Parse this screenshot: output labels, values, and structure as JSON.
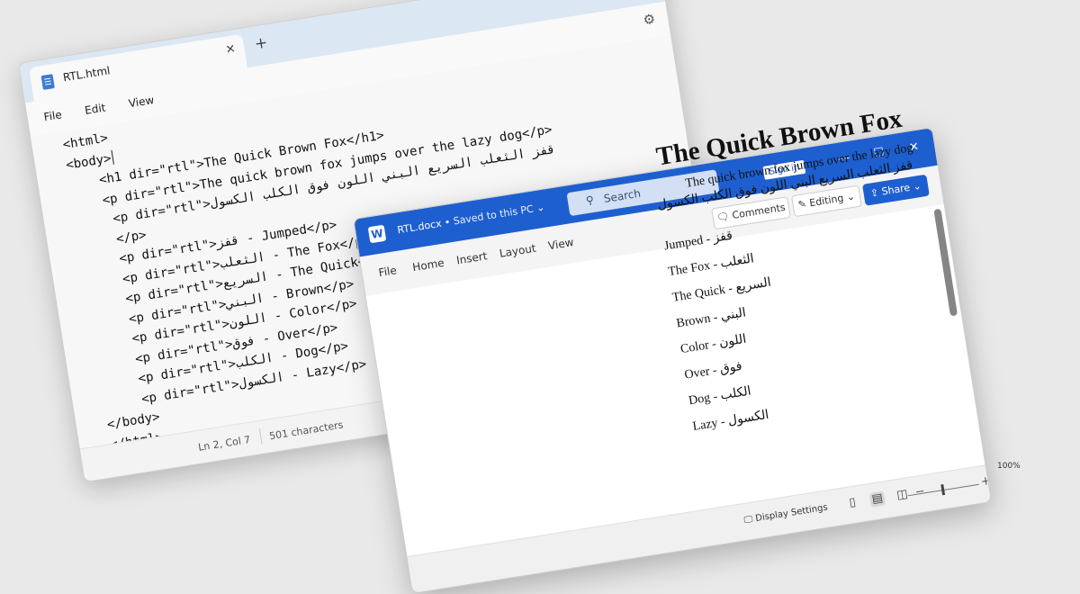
{
  "notepad": {
    "tab_title": "RTL.html",
    "tab_close": "✕",
    "new_tab": "+",
    "menu": [
      "File",
      "Edit",
      "View"
    ],
    "code_lines": [
      "<html>",
      "<body>",
      "    <h1 dir=\"rtl\">The Quick Brown Fox</h1>",
      "    <p dir=\"rtl\">The quick brown fox jumps over the lazy dog</p>",
      "     <p dir=\"rtl\">قفز الثعلب السريع البني اللون فوق الكلب الكسول",
      "     </p>",
      "     <p dir=\"rtl\">قفز - Jumped</p>",
      "     <p dir=\"rtl\">الثعلب - The Fox</p>",
      "     <p dir=\"rtl\">السريع - The Quick</p>",
      "     <p dir=\"rtl\">البني - Brown</p>",
      "     <p dir=\"rtl\">اللون - Color</p>",
      "     <p dir=\"rtl\">فوق - Over</p>",
      "     <p dir=\"rtl\">الكلب - Dog</p>",
      "     <p dir=\"rtl\">الكسول - Lazy</p>",
      "</body>",
      "</html>"
    ],
    "status": {
      "position": "Ln 2, Col 7",
      "characters": "501 characters"
    }
  },
  "word": {
    "logo": "W",
    "doc_name": "RTL.docx",
    "saved": "Saved to this PC",
    "search_placeholder": "Search",
    "sign_in": "Sign in",
    "window_controls": {
      "minimize": "—",
      "maximize": "☐",
      "close": "✕"
    },
    "menu": [
      "File",
      "Home",
      "Insert",
      "Layout",
      "View"
    ],
    "comments": "Comments",
    "editing": "Editing",
    "share": "Share",
    "status": {
      "display_settings": "Display Settings",
      "zoom": "100%",
      "zoom_minus": "−",
      "zoom_plus": "+"
    },
    "document": {
      "heading": "The Quick Brown Fox",
      "line_en": "The quick brown fox jumps over the lazy dog",
      "line_ar": "قفز الثعلب السريع البني اللون فوق الكلب الكسول",
      "pairs": [
        "قفز - Jumped",
        "الثعلب - The Fox",
        "السريع - The Quick",
        "البني - Brown",
        "اللون - Color",
        "فوق - Over",
        "الكلب - Dog",
        "الكسول - Lazy"
      ]
    }
  },
  "colors": {
    "word_blue": "#1e5fd0",
    "notepad_title": "#dbe7f2",
    "background": "#e9e9e9"
  }
}
